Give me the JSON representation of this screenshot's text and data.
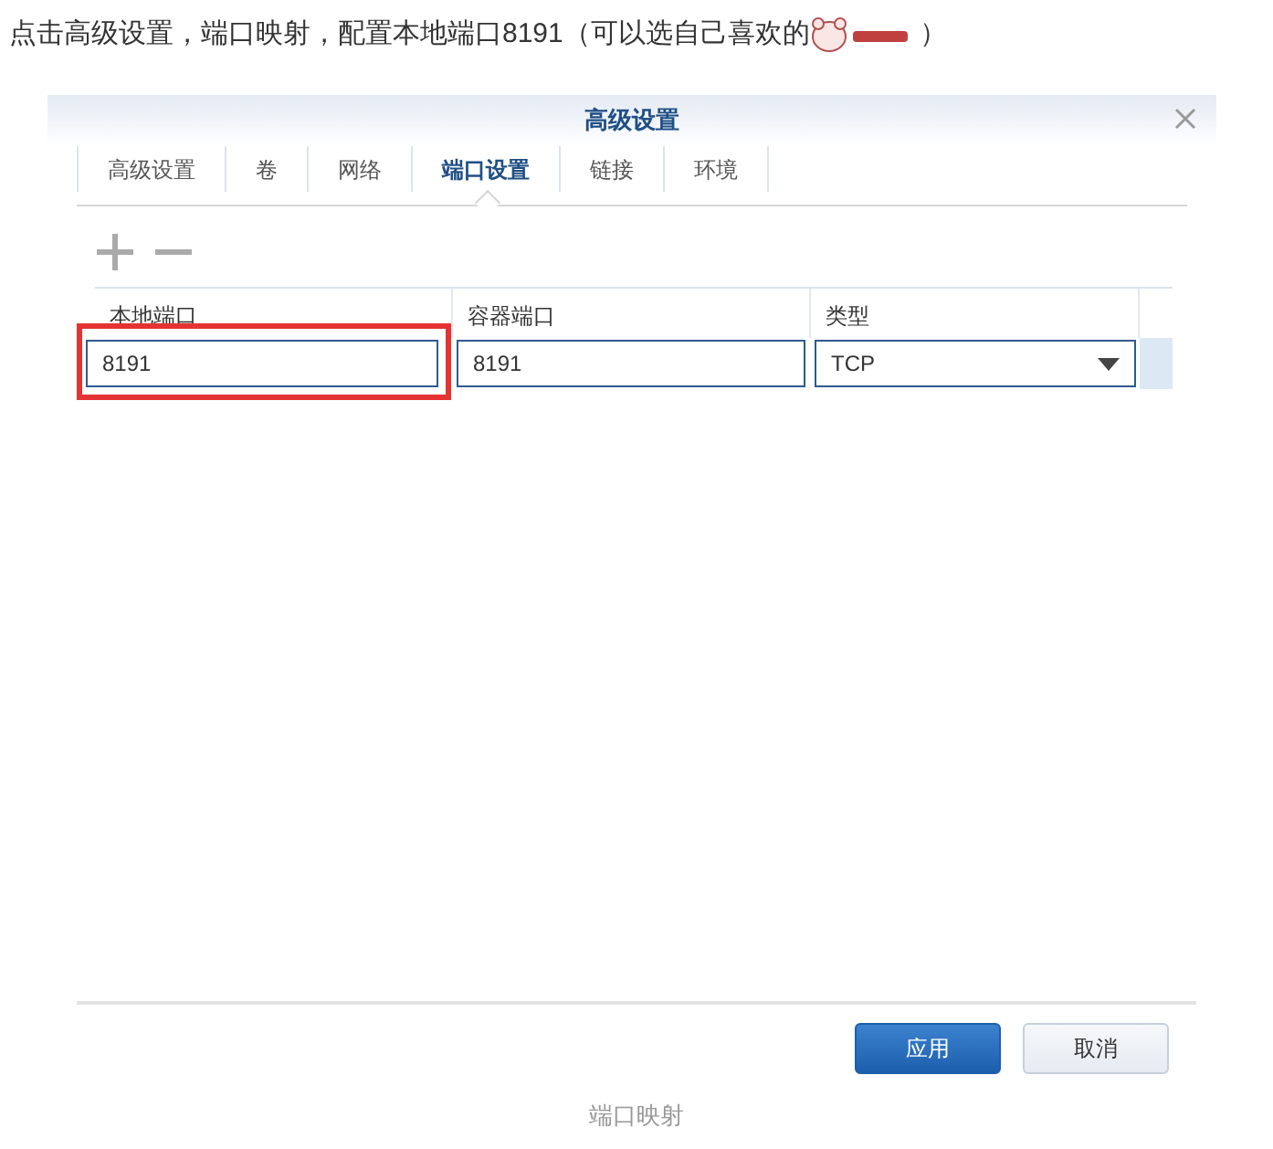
{
  "intro": "点击高级设置，端口映射，配置本地端口8191（可以选自己喜欢的",
  "intro_end": "）",
  "dialog": {
    "title": "高级设置",
    "tabs": [
      {
        "label": "高级设置",
        "selected": false
      },
      {
        "label": "卷",
        "selected": false
      },
      {
        "label": "网络",
        "selected": false
      },
      {
        "label": "端口设置",
        "selected": true
      },
      {
        "label": "链接",
        "selected": false
      },
      {
        "label": "环境",
        "selected": false
      }
    ],
    "table": {
      "columns": [
        "本地端口",
        "容器端口",
        "类型"
      ],
      "rows": [
        {
          "local_port": "8191",
          "container_port": "8191",
          "type": "TCP",
          "highlighted": true
        }
      ]
    },
    "buttons": [
      {
        "label": "应用",
        "kind": "primary"
      },
      {
        "label": "取消",
        "kind": "secondary"
      }
    ]
  },
  "caption": "端口映射"
}
